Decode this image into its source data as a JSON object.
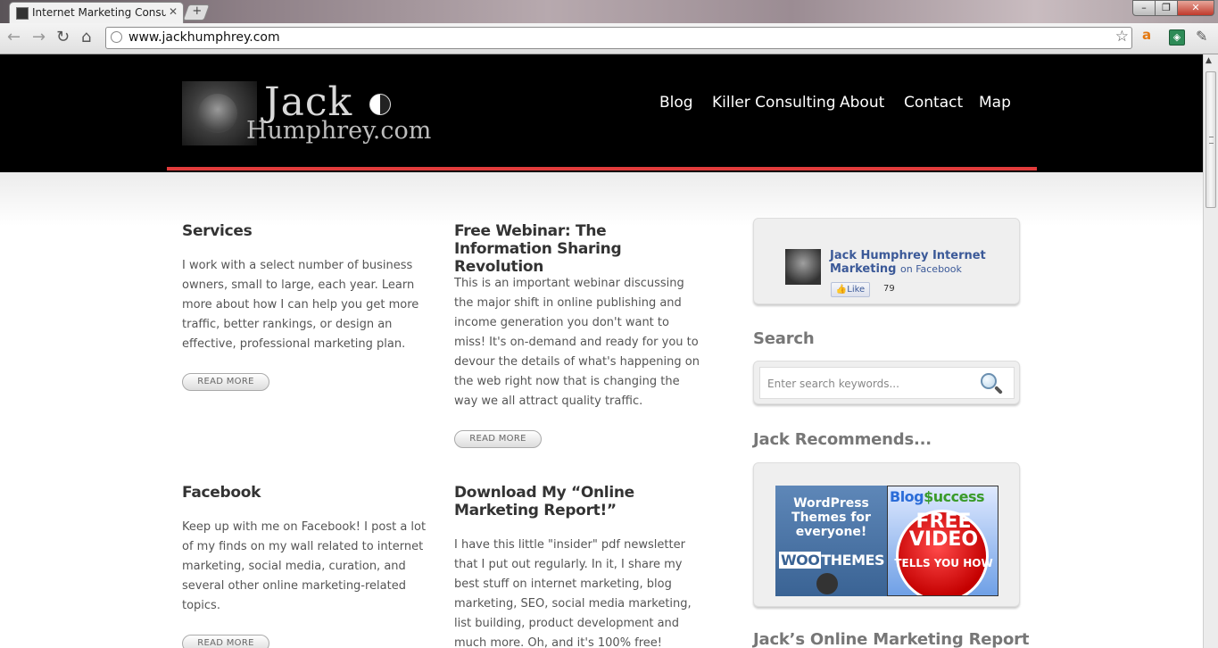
{
  "browser": {
    "tab_title": "Internet Marketing Consult",
    "new_tab_symbol": "+",
    "url": "www.jackhumphrey.com",
    "window_controls": {
      "minimize": "–",
      "maximize": "❐",
      "close": "✕"
    }
  },
  "header": {
    "logo_line1": "Jack",
    "logo_line2": "Humphrey.com",
    "nav": [
      "Blog",
      "Killer Consulting",
      "About",
      "Contact",
      "Map"
    ],
    "accent_color": "#e23b3b"
  },
  "posts": {
    "services": {
      "title": "Services",
      "body": "I work with a select number of business owners, small to large, each year. Learn more about how I can help you get more traffic, better rankings, or design an effective, professional marketing plan.",
      "read_more": "READ MORE"
    },
    "webinar": {
      "title": "Free Webinar: The Information Sharing Revolution",
      "body": "This is an important webinar discussing the major shift in online publishing and income generation you don't want to miss! It's on-demand and ready for you to devour the details of what's happening on the web right now that is changing the way we all attract quality traffic.",
      "read_more": "READ MORE"
    },
    "facebook": {
      "title": "Facebook",
      "body": "Keep up with me on Facebook! I post a lot of my finds on my wall related to internet marketing, social media, curation, and several other online marketing-related topics.",
      "read_more": "READ MORE"
    },
    "report": {
      "title": "Download My “Online Marketing Report!”",
      "body": "I have this little \"insider\" pdf newsletter that I put out regularly. In it, I share my best stuff on internet marketing, blog marketing, SEO, social media marketing, list building, product development and much more. Oh, and it's 100% free!"
    }
  },
  "sidebar": {
    "facebook": {
      "name": "Jack Humphrey Internet Marketing",
      "on_facebook": "on Facebook",
      "like_label": "Like",
      "like_count": "79"
    },
    "search_title": "Search",
    "search_placeholder": "Enter search keywords...",
    "recommends_title": "Jack Recommends...",
    "ad_woo": {
      "headline": "WordPress Themes for everyone!",
      "brand_a": "WOO",
      "brand_b": "THEMES"
    },
    "ad_blog": {
      "logo_a": "Blog",
      "logo_b": "$uccess",
      "free": "FREE VIDEO",
      "tells": "TELLS YOU HOW"
    },
    "report_title": "Jack’s Online Marketing Report"
  }
}
